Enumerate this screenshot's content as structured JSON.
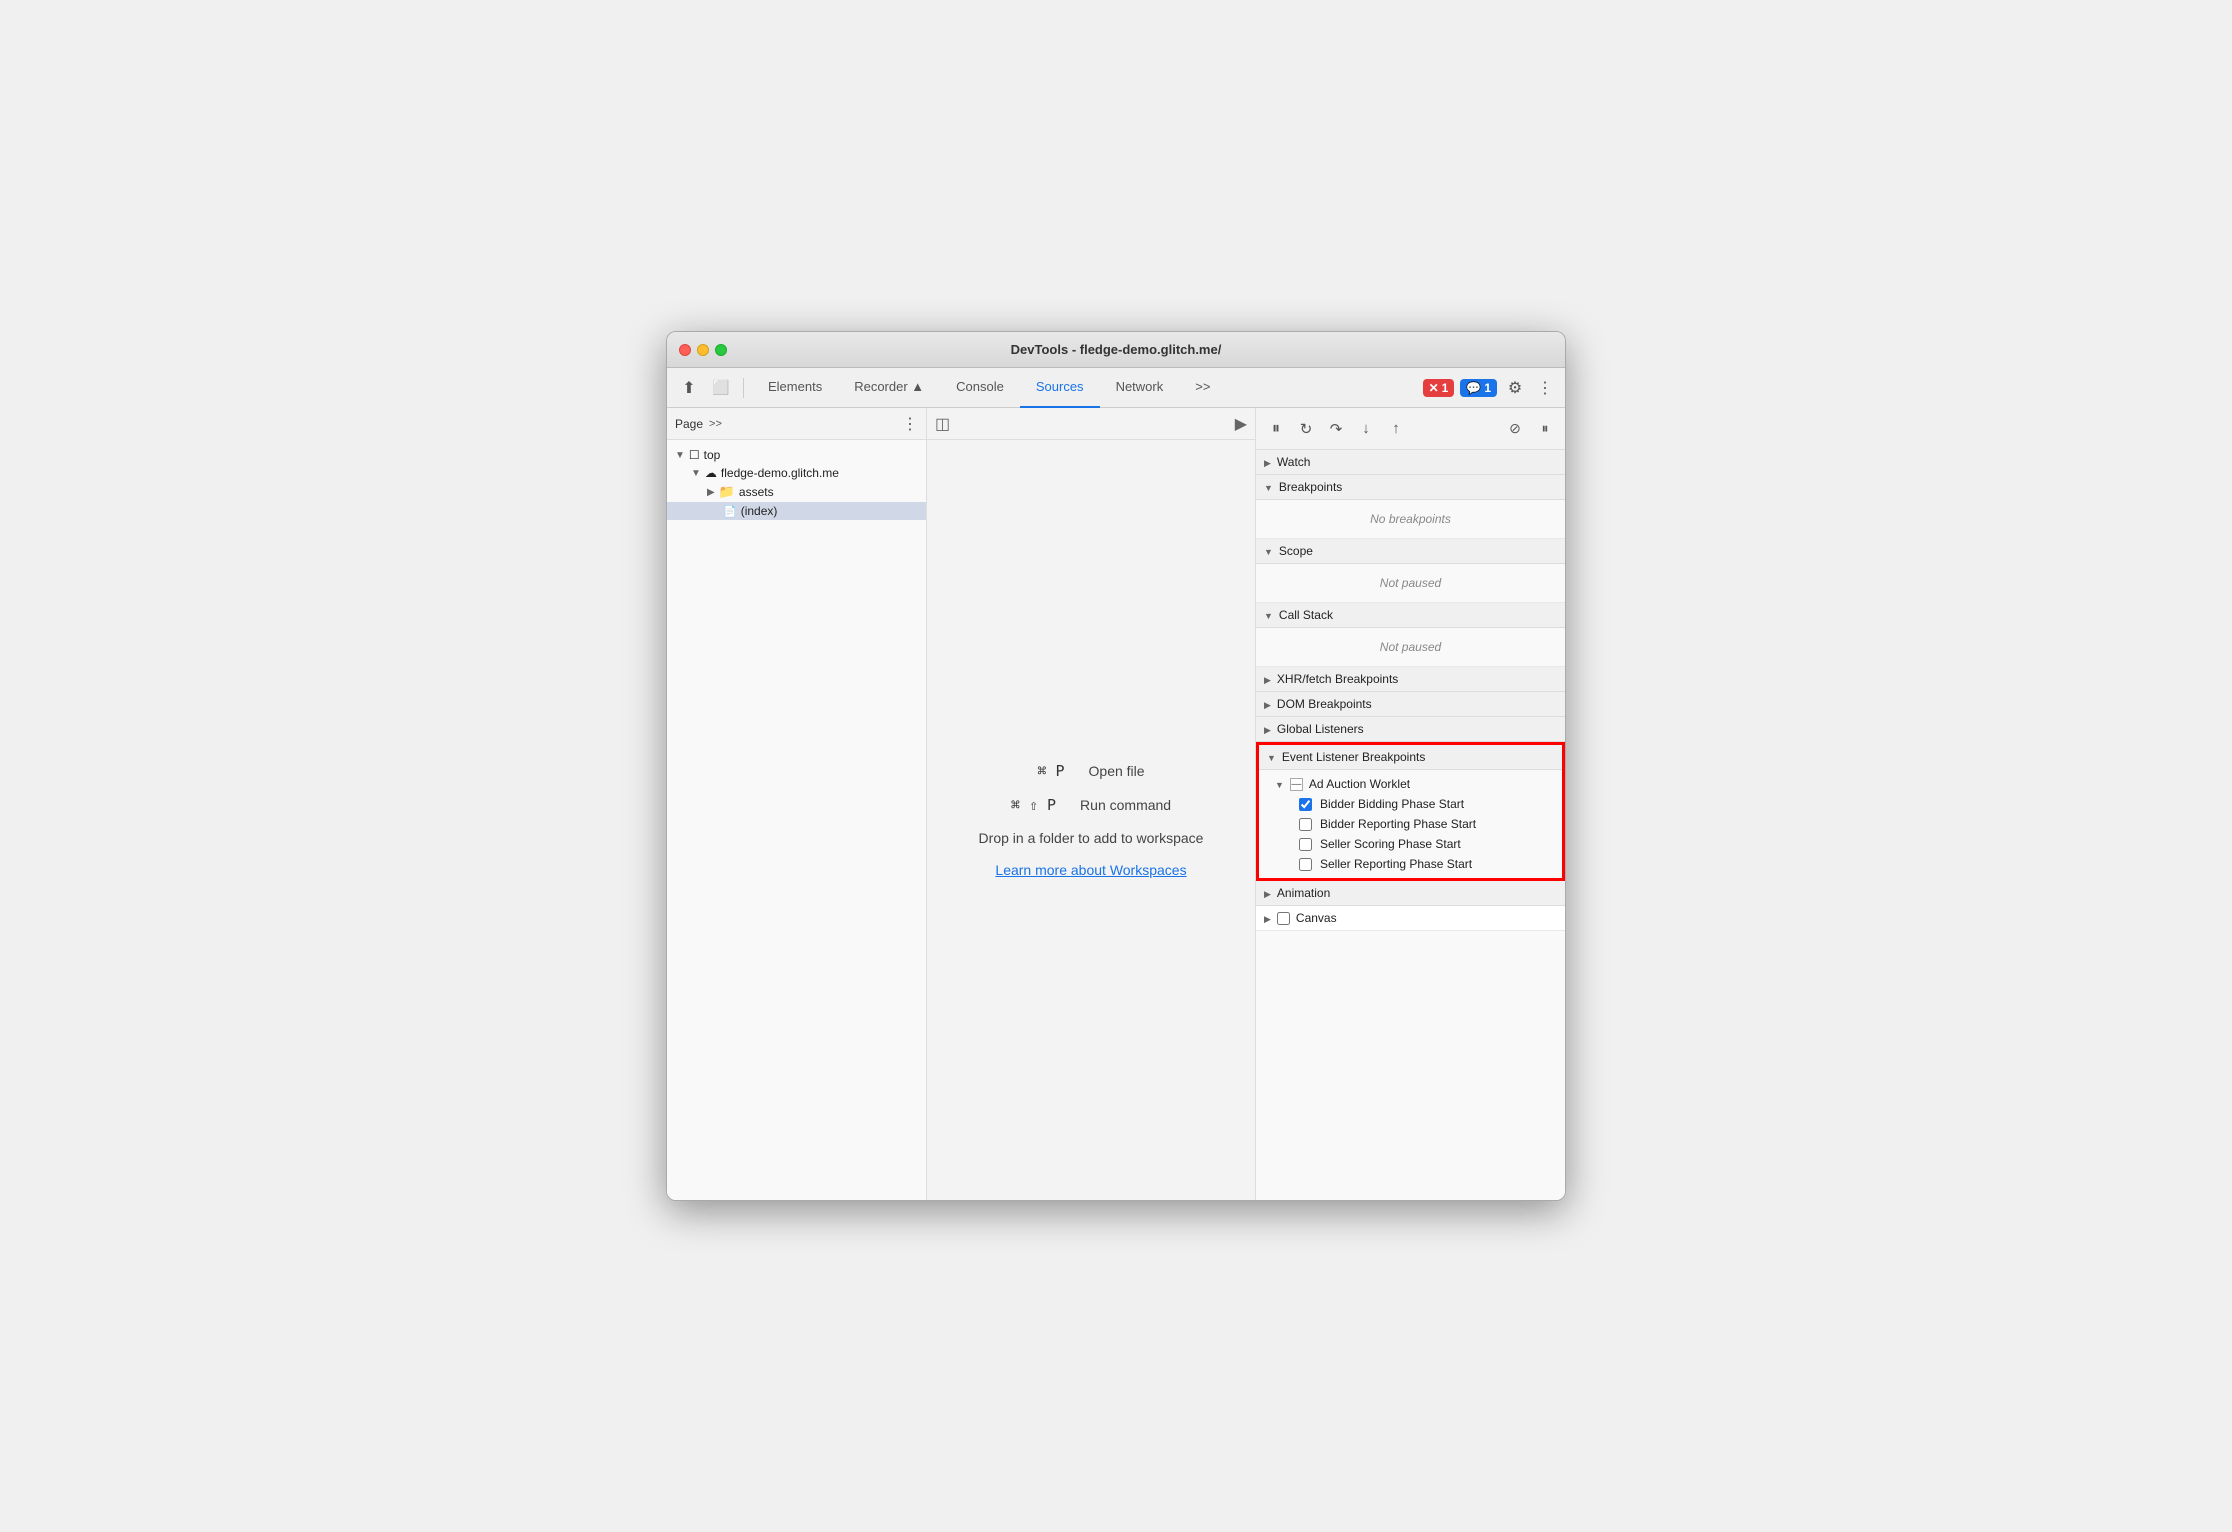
{
  "window": {
    "title": "DevTools - fledge-demo.glitch.me/"
  },
  "titlebar": {
    "title": "DevTools - fledge-demo.glitch.me/"
  },
  "toolbar": {
    "tabs": [
      {
        "label": "Elements",
        "active": false
      },
      {
        "label": "Recorder ▲",
        "active": false
      },
      {
        "label": "Console",
        "active": false
      },
      {
        "label": "Sources",
        "active": true
      },
      {
        "label": "Network",
        "active": false
      }
    ],
    "more_tabs_label": ">>",
    "errors_count": "1",
    "messages_count": "1"
  },
  "left_panel": {
    "label": "Page",
    "more_label": ">>",
    "tree": [
      {
        "label": "top",
        "level": 0,
        "expanded": true,
        "type": "folder"
      },
      {
        "label": "fledge-demo.glitch.me",
        "level": 1,
        "expanded": true,
        "type": "cloud"
      },
      {
        "label": "assets",
        "level": 2,
        "expanded": false,
        "type": "folder"
      },
      {
        "label": "(index)",
        "level": 2,
        "expanded": false,
        "type": "file",
        "selected": true
      }
    ]
  },
  "middle_panel": {
    "open_file_shortcut": "⌘ P",
    "open_file_label": "Open file",
    "run_command_shortcut": "⌘ ⇧ P",
    "run_command_label": "Run command",
    "workspace_text": "Drop in a folder to add to workspace",
    "workspace_link": "Learn more about Workspaces"
  },
  "right_panel": {
    "sections": [
      {
        "id": "watch",
        "label": "Watch",
        "expanded": false,
        "chevron": "right"
      },
      {
        "id": "breakpoints",
        "label": "Breakpoints",
        "expanded": true,
        "chevron": "down",
        "empty_text": "No breakpoints"
      },
      {
        "id": "scope",
        "label": "Scope",
        "expanded": true,
        "chevron": "down",
        "empty_text": "Not paused"
      },
      {
        "id": "call_stack",
        "label": "Call Stack",
        "expanded": true,
        "chevron": "down",
        "empty_text": "Not paused"
      },
      {
        "id": "xhr_breakpoints",
        "label": "XHR/fetch Breakpoints",
        "expanded": false,
        "chevron": "right"
      },
      {
        "id": "dom_breakpoints",
        "label": "DOM Breakpoints",
        "expanded": false,
        "chevron": "right"
      },
      {
        "id": "global_listeners",
        "label": "Global Listeners",
        "expanded": false,
        "chevron": "right"
      },
      {
        "id": "event_listener_breakpoints",
        "label": "Event Listener Breakpoints",
        "expanded": true,
        "chevron": "down",
        "highlighted": true,
        "worklets": [
          {
            "label": "Ad Auction Worklet",
            "expanded": true,
            "items": [
              {
                "label": "Bidder Bidding Phase Start",
                "checked": true
              },
              {
                "label": "Bidder Reporting Phase Start",
                "checked": false
              },
              {
                "label": "Seller Scoring Phase Start",
                "checked": false
              },
              {
                "label": "Seller Reporting Phase Start",
                "checked": false
              }
            ]
          }
        ]
      },
      {
        "id": "animation",
        "label": "Animation",
        "expanded": false,
        "chevron": "right"
      },
      {
        "id": "canvas",
        "label": "Canvas",
        "expanded": false,
        "chevron": "right",
        "has_checkbox": true
      }
    ]
  },
  "debug_toolbar": {
    "pause_label": "⏸",
    "resume_label": "↺",
    "step_over_label": "↓",
    "step_into_label": "↑",
    "step_out_label": "↗",
    "deactivate_label": "⊘",
    "pause_on_exception_label": "⏸"
  }
}
